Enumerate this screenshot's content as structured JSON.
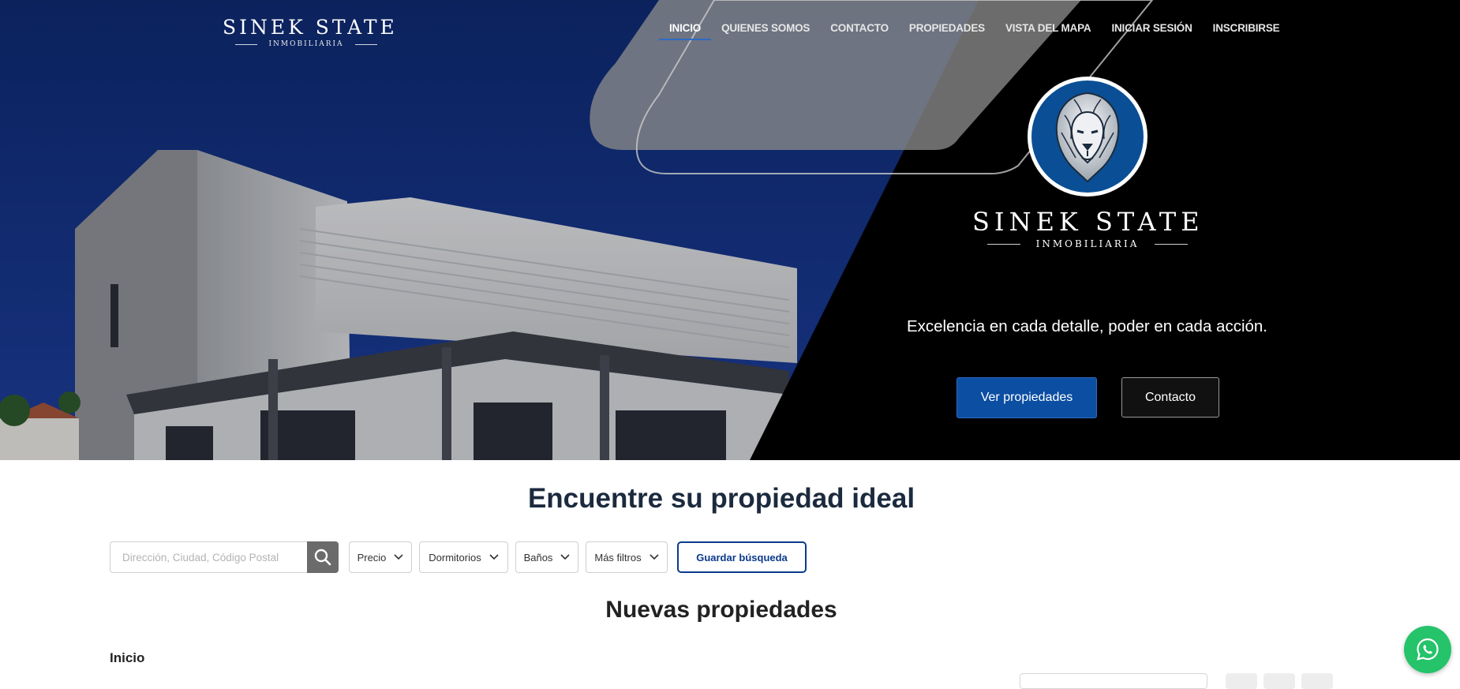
{
  "header": {
    "brand_name": "SINEK STATE",
    "brand_sub": "INMOBILIARIA"
  },
  "nav": {
    "items": [
      {
        "label": "INICIO",
        "active": true
      },
      {
        "label": "QUIENES SOMOS",
        "active": false
      },
      {
        "label": "CONTACTO",
        "active": false
      },
      {
        "label": "PROPIEDADES",
        "active": false
      },
      {
        "label": "VISTA DEL MAPA",
        "active": false
      },
      {
        "label": "INICIAR SESIÓN",
        "active": false
      },
      {
        "label": "INSCRIBIRSE",
        "active": false
      }
    ]
  },
  "hero": {
    "brand_name": "SINEK STATE",
    "brand_sub": "INMOBILIARIA",
    "tagline": "Excelencia en cada detalle, poder en cada acción.",
    "primary_button": "Ver propiedades",
    "secondary_button": "Contacto"
  },
  "search": {
    "title": "Encuentre su propiedad ideal",
    "placeholder": "Dirección, Ciudad, Código Postal",
    "filters": [
      "Precio",
      "Dormitorios",
      "Baños",
      "Más filtros"
    ],
    "save_label": "Guardar búsqueda"
  },
  "listings": {
    "heading": "Nuevas propiedades",
    "breadcrumb": "Inicio"
  },
  "icons": {
    "search": "search-icon",
    "chevron": "chevron-down-icon",
    "whatsapp": "whatsapp-icon",
    "lion": "lion-logo-icon"
  },
  "colors": {
    "brand_blue": "#0b4ea2",
    "title_navy": "#1c2a3e",
    "save_border": "#0b3a8c",
    "whatsapp_green": "#25c36a"
  }
}
